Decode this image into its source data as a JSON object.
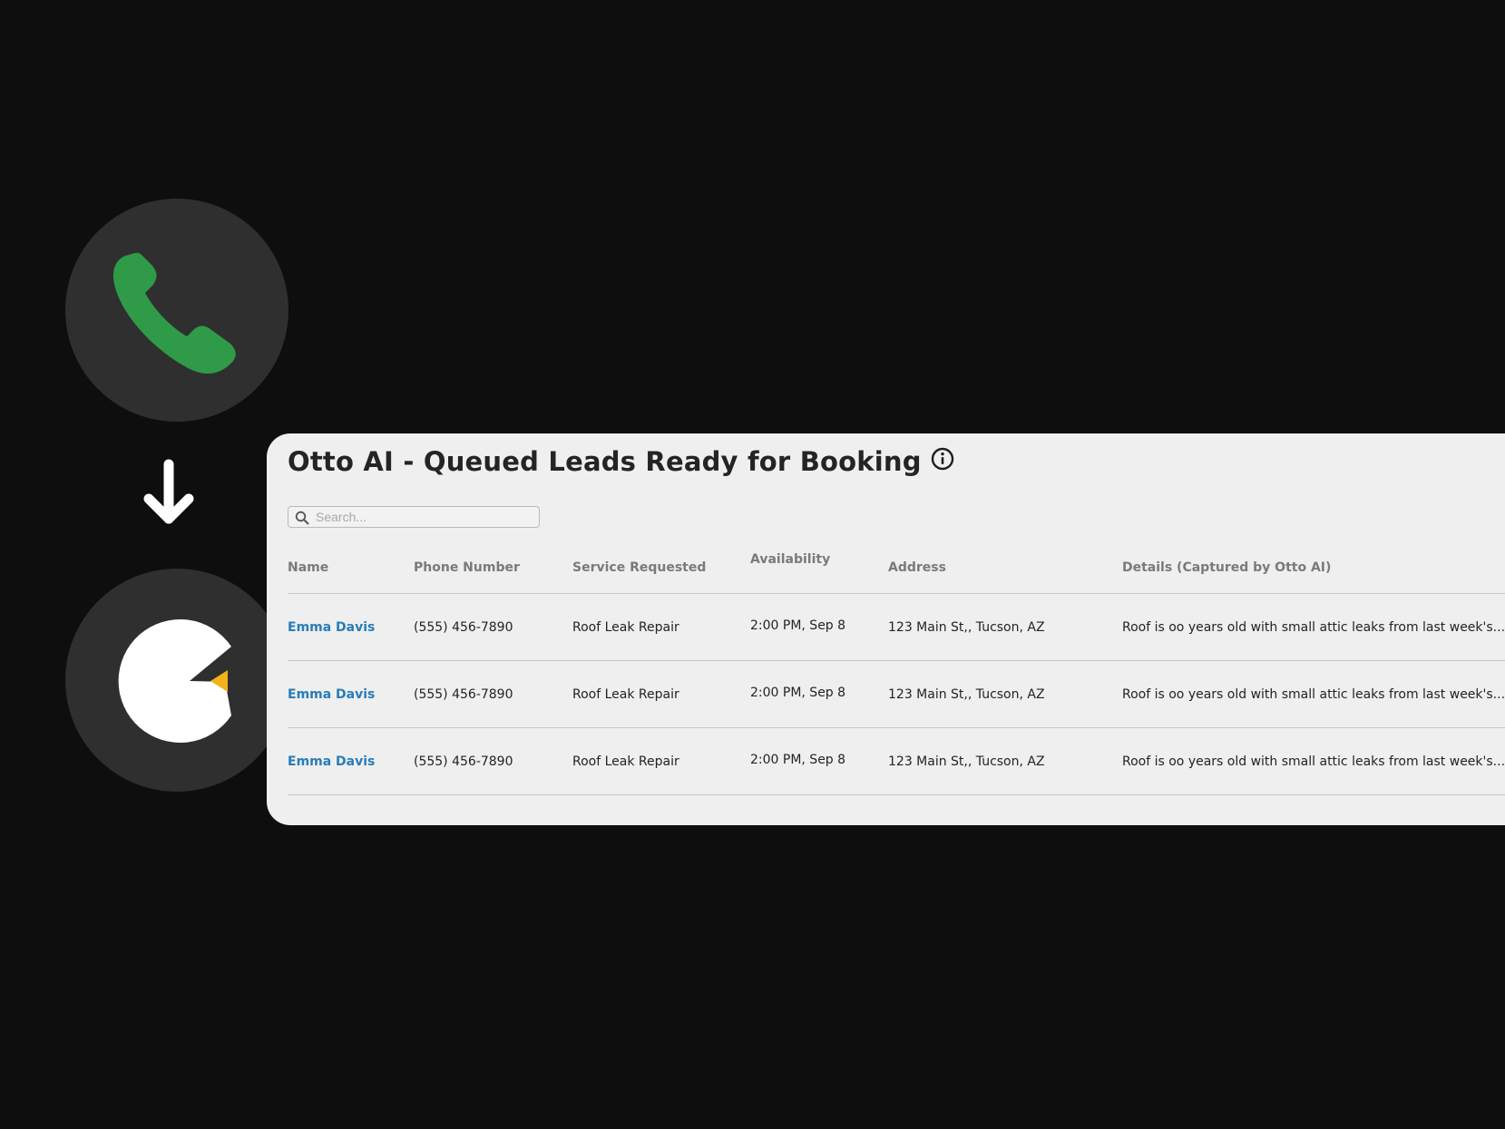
{
  "card": {
    "title": "Otto AI - Queued Leads Ready for Booking"
  },
  "search": {
    "placeholder": "Search..."
  },
  "table": {
    "columns": [
      "Name",
      "Phone Number",
      "Service Requested",
      "Availability",
      "Address",
      "Details (Captured by Otto AI)"
    ],
    "rows": [
      {
        "name": "Emma Davis",
        "phone": "(555) 456-7890",
        "service": "Roof Leak Repair",
        "availability": "2:00 PM, Sep 8",
        "address": "123 Main St,, Tucson, AZ",
        "details": "Roof is oo years old with small attic leaks from last week's..."
      },
      {
        "name": "Emma Davis",
        "phone": "(555) 456-7890",
        "service": "Roof Leak Repair",
        "availability": "2:00 PM, Sep 8",
        "address": "123 Main St,, Tucson, AZ",
        "details": "Roof is oo years old with small attic leaks from last week's..."
      },
      {
        "name": "Emma Davis",
        "phone": "(555) 456-7890",
        "service": "Roof Leak Repair",
        "availability": "2:00 PM, Sep 8",
        "address": "123 Main St,, Tucson, AZ",
        "details": "Roof is oo years old with small attic leaks from last week's..."
      }
    ]
  },
  "icons": {
    "phone": "phone-icon",
    "arrow": "arrow-down-icon",
    "otto_logo": "otto-logo-icon",
    "info": "info-icon",
    "search": "search-icon"
  },
  "colors": {
    "background": "#0e0e0e",
    "circle": "#2f2f2f",
    "phone_green": "#2f9a47",
    "logo_accent": "#f2b21b",
    "link_blue": "#2a7cb7",
    "card": "#efefef"
  }
}
